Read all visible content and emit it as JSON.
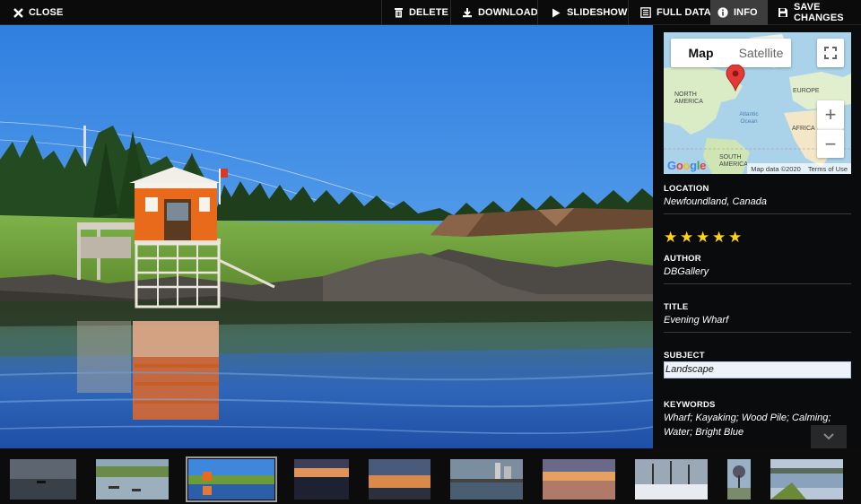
{
  "toolbar": {
    "close_label": "CLOSE",
    "delete_label": "DELETE",
    "download_label": "DOWNLOAD",
    "slideshow_label": "SLIDESHOW",
    "full_data_label": "FULL DATA",
    "info_label": "INFO",
    "save_changes_label": "SAVE CHANGES"
  },
  "map": {
    "map_tab": "Map",
    "satellite_tab": "Satellite",
    "zoom_in": "+",
    "zoom_out": "−",
    "labels": {
      "north_america": "NORTH AMERICA",
      "atlantic": "Atlantic Ocean",
      "europe": "EUROPE",
      "africa": "AFRICA",
      "south_america": "SOUTH AMERICA"
    },
    "google": "Google",
    "map_data": "Map data ©2020",
    "terms": "Terms of Use"
  },
  "info": {
    "location_label": "LOCATION",
    "location_value": "Newfoundland, Canada",
    "rating": 5,
    "author_label": "AUTHOR",
    "author_value": "DBGallery",
    "title_label": "TITLE",
    "title_value": "Evening Wharf",
    "subject_label": "SUBJECT",
    "subject_value": "Landscape",
    "keywords_label": "KEYWORDS",
    "keywords_value": "Wharf; Kayaking; Wood Pile; Calming; Water; Bright Blue"
  },
  "filmstrip": {
    "selected_index": 2,
    "thumbnails": [
      "kayak-dusk",
      "boats-lake",
      "evening-wharf",
      "sunset-shore",
      "sunset-water",
      "city-bridge",
      "sunset-horizon",
      "snowy-trees",
      "tree-field",
      "lake-grass"
    ]
  },
  "colors": {
    "toolbar_bg": "#0b0b0b",
    "active_tab_bg": "#3d3d3d",
    "star": "#ffd21a",
    "map_pin": "#e53935"
  }
}
